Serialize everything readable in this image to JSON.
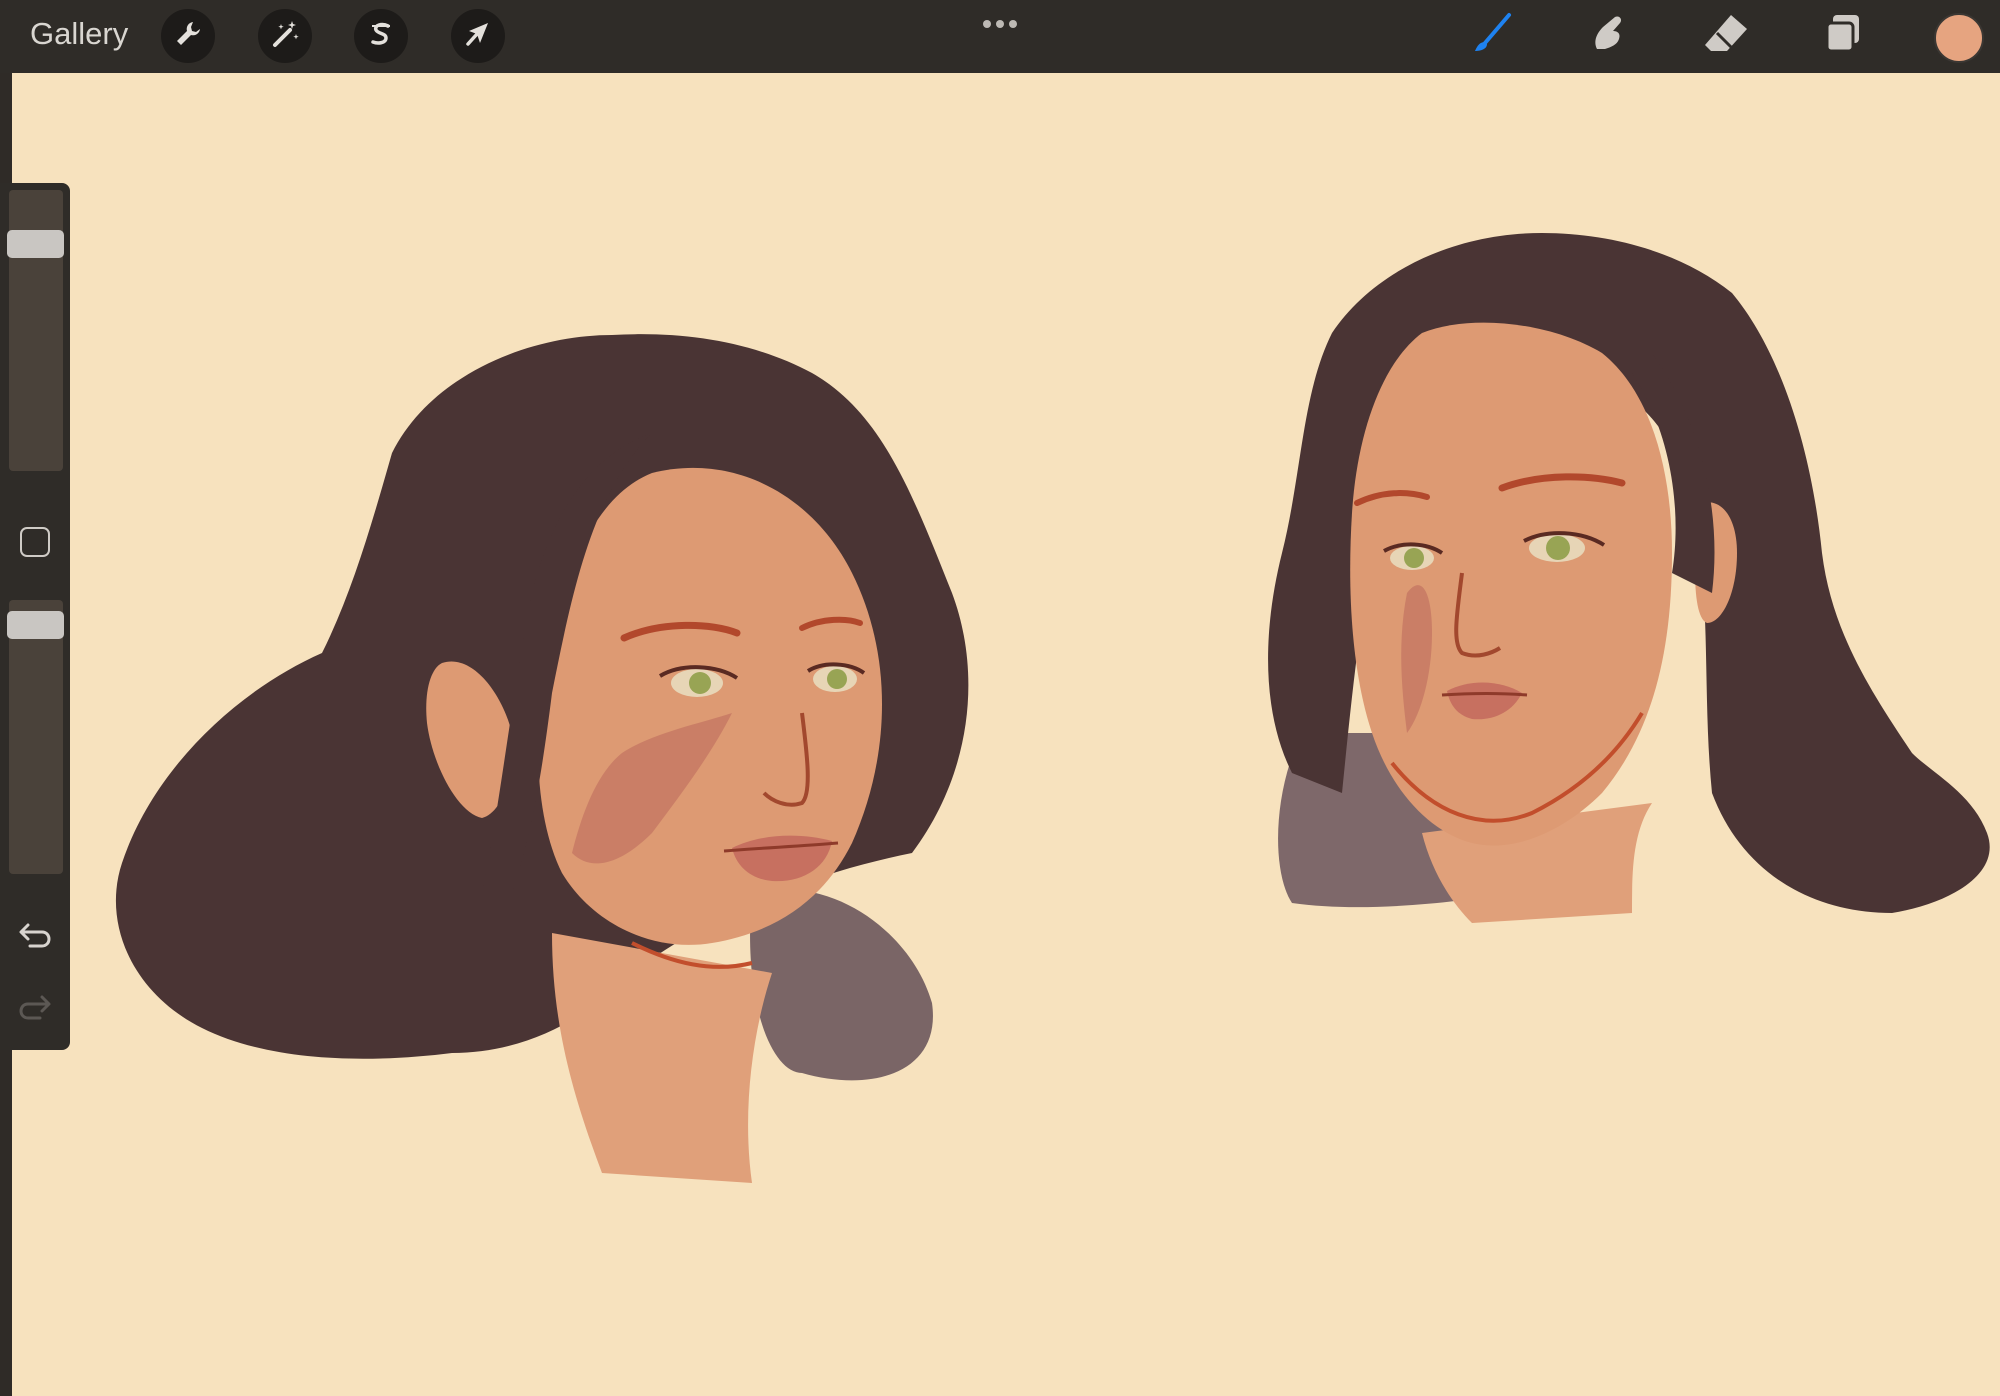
{
  "app": {
    "gallery_label": "Gallery"
  },
  "toolbar_left": [
    {
      "name": "actions",
      "icon": "wrench-icon"
    },
    {
      "name": "adjustments",
      "icon": "magic-wand-icon"
    },
    {
      "name": "selection",
      "icon": "selection-s-icon"
    },
    {
      "name": "transform",
      "icon": "arrow-cursor-icon"
    }
  ],
  "toolbar_right": [
    {
      "name": "brush",
      "icon": "brush-icon",
      "active": true
    },
    {
      "name": "smudge",
      "icon": "smudge-finger-icon",
      "active": false
    },
    {
      "name": "eraser",
      "icon": "eraser-icon",
      "active": false
    },
    {
      "name": "layers",
      "icon": "layers-icon",
      "active": false
    }
  ],
  "colors": {
    "current_color": "#e6a480",
    "active_tool": "#1e82f0",
    "canvas_bg": "#f7e2be",
    "hair": "#4a3434",
    "skin": "#dd9a73"
  },
  "sidebar": {
    "brush_size_level": 0.85,
    "opacity_level": 0.9,
    "undo_icon": "undo-icon",
    "redo_icon": "redo-icon",
    "modify_icon": "square-modify-icon"
  }
}
